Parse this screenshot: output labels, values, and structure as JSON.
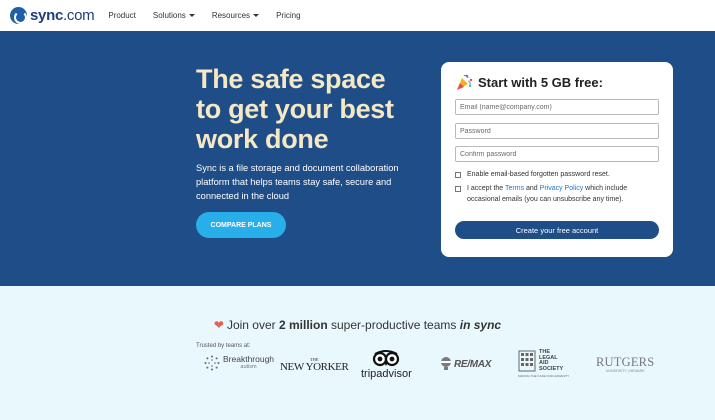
{
  "nav": {
    "logo_main": "sync",
    "logo_suffix": ".com",
    "items": [
      {
        "label": "Product",
        "has_caret": false
      },
      {
        "label": "Solutions",
        "has_caret": true
      },
      {
        "label": "Resources",
        "has_caret": true
      },
      {
        "label": "Pricing",
        "has_caret": false
      }
    ]
  },
  "hero": {
    "headline_lines": [
      "The safe space",
      "to get your best",
      "work done"
    ],
    "lede": "Sync is a file storage and document collaboration platform that helps teams stay safe, secure and connected in the cloud",
    "cta_label": "COMPARE PLANS"
  },
  "signup": {
    "title": "Start with 5 GB free:",
    "email_placeholder": "Email (name@company.com)",
    "password_placeholder": "Password",
    "confirm_placeholder": "Confirm password",
    "reset_label": "Enable email-based forgotten password reset.",
    "terms_pre": "I accept the ",
    "terms_link": "Terms",
    "terms_mid": " and ",
    "privacy_link": "Privacy Policy",
    "terms_post": " which include occasional emails (you can unsubscribe any time).",
    "submit_label": "Create your free account"
  },
  "social": {
    "join_pre": "Join over ",
    "join_bold": "2 million",
    "join_mid": " super-productive teams ",
    "join_em": "in sync",
    "trusted_label": "Trusted by teams at:",
    "logos": {
      "breakthrough": "Breakthrough",
      "breakthrough_sub": "autism",
      "newyorker_the": "THE",
      "newyorker": "NEW YORKER",
      "tripadvisor": "tripadvisor",
      "remax": "RE/MAX",
      "legal_aid_lines": [
        "THE",
        "LEGAL",
        "AID",
        "SOCIETY"
      ],
      "legal_aid_tagline": "MAKING THE CASE FOR HUMANITY",
      "rutgers": "RUTGERS",
      "rutgers_sub": "UNIVERSITY | NEWARK"
    }
  },
  "colors": {
    "hero_bg": "#1e4d87",
    "headline": "#f5e8c4",
    "cta": "#28aee9",
    "lower_bg": "#e9f8fd",
    "link": "#2874c4"
  }
}
